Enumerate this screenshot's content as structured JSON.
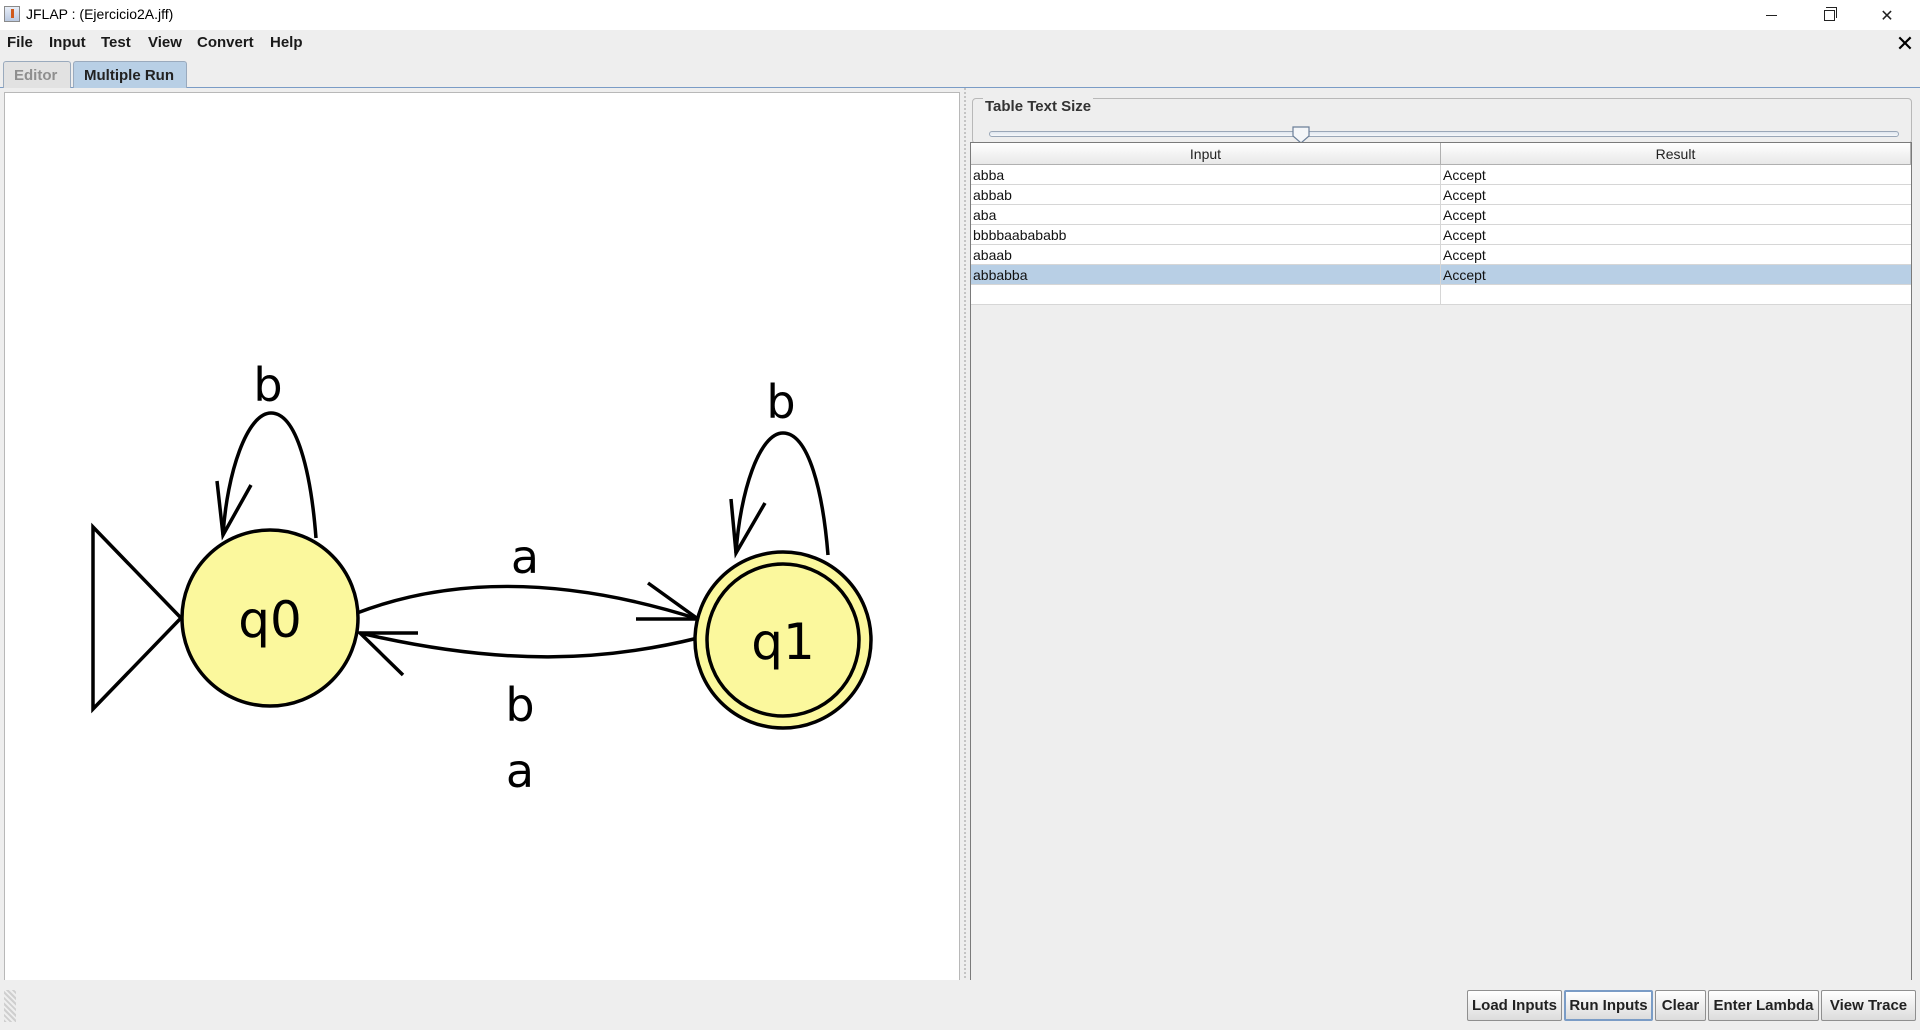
{
  "window": {
    "title": "JFLAP : (Ejercicio2A.jff)"
  },
  "menu": [
    "File",
    "Input",
    "Test",
    "View",
    "Convert",
    "Help"
  ],
  "tabs": [
    {
      "label": "Editor",
      "active": false
    },
    {
      "label": "Multiple Run",
      "active": true
    }
  ],
  "automaton": {
    "states": [
      {
        "name": "q0",
        "initial": true,
        "final": false
      },
      {
        "name": "q1",
        "initial": false,
        "final": true
      }
    ],
    "transitions": [
      {
        "from": "q0",
        "to": "q0",
        "label": "b"
      },
      {
        "from": "q0",
        "to": "q1",
        "label": "a"
      },
      {
        "from": "q1",
        "to": "q0",
        "label": "b"
      },
      {
        "from": "q1",
        "to": "q0",
        "label": "a"
      },
      {
        "from": "q1",
        "to": "q1",
        "label": "b"
      }
    ],
    "colors": {
      "state_fill": "#fbf89d",
      "stroke": "#000000"
    }
  },
  "panel": {
    "slider_title": "Table Text Size",
    "table": {
      "headers": [
        "Input",
        "Result"
      ],
      "rows": [
        {
          "input": "abba",
          "result": "Accept"
        },
        {
          "input": "abbab",
          "result": "Accept"
        },
        {
          "input": "aba",
          "result": "Accept"
        },
        {
          "input": "bbbbaabababb",
          "result": "Accept"
        },
        {
          "input": "abaab",
          "result": "Accept"
        },
        {
          "input": "abbabba",
          "result": "Accept",
          "selected": true
        },
        {
          "input": "",
          "result": ""
        }
      ]
    }
  },
  "buttons": {
    "load": "Load Inputs",
    "run": "Run Inputs",
    "clear": "Clear",
    "lambda": "Enter Lambda",
    "trace": "View Trace"
  },
  "colors": {
    "selection": "#b8cfe5",
    "panel_bg": "#eeeeee"
  }
}
